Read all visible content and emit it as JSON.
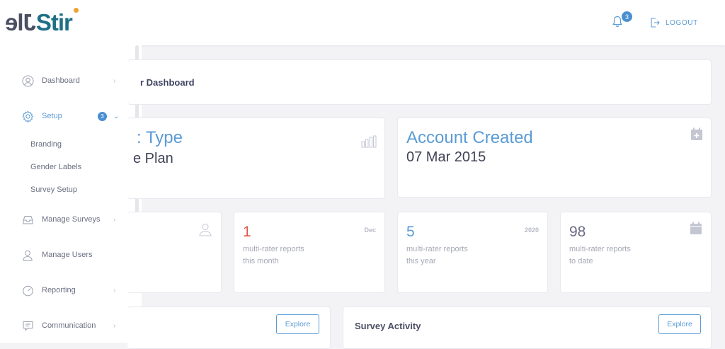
{
  "header": {
    "logo_reversed": "Jle",
    "logo_text": "Stir",
    "notification_count": "3",
    "logout_label": "LOGOUT"
  },
  "sidebar": {
    "items": [
      {
        "label": "Dashboard",
        "icon": "user-circle-icon"
      },
      {
        "label": "Setup",
        "icon": "gear-icon",
        "badge": "3"
      },
      {
        "label": "Manage Surveys",
        "icon": "inbox-icon"
      },
      {
        "label": "Manage Users",
        "icon": "users-icon"
      },
      {
        "label": "Reporting",
        "icon": "gauge-icon"
      },
      {
        "label": "Communication",
        "icon": "chat-icon"
      }
    ],
    "setup_subitems": [
      "Branding",
      "Gender Labels",
      "Survey Setup"
    ]
  },
  "main": {
    "page_title": "r Dashboard",
    "account_type": {
      "title": ": Type",
      "value": "e Plan"
    },
    "account_created": {
      "title": "Account Created",
      "value": "07 Mar 2015"
    },
    "stats": [
      {
        "number": "1",
        "tag": "Dec",
        "desc_line1": "multi-rater reports",
        "desc_line2": "this month",
        "color": "#e2574c"
      },
      {
        "number": "5",
        "tag": "2020",
        "desc_line1": "multi-rater reports",
        "desc_line2": "this year",
        "color": "#5b9bd5"
      },
      {
        "number": "98",
        "tag": "",
        "desc_line1": "multi-rater reports",
        "desc_line2": "to date",
        "color": "#6a6a86"
      }
    ],
    "explore_label": "Explore",
    "survey_activity_title": "Survey Activity"
  }
}
